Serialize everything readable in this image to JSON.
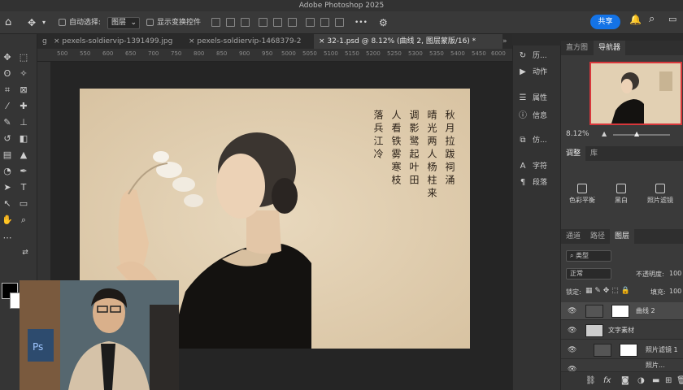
{
  "app": {
    "title": "Adobe Photoshop 2025"
  },
  "options_bar": {
    "auto_select_label": "自动选择:",
    "auto_select_value": "图层",
    "show_transform_label": "显示变换控件",
    "more": "•••",
    "share": "共享"
  },
  "tabs": [
    {
      "label": "g"
    },
    {
      "label": "pexels-soldiervip-1391499.jpg",
      "close": "×"
    },
    {
      "label": "pexels-soldiervip-1468379-2",
      "close": "×"
    },
    {
      "label": "32-1.psd @ 8.12% (曲线 2, 图层蒙版/16) *",
      "close": "×"
    }
  ],
  "ruler_marks": [
    "500",
    "550",
    "600",
    "650",
    "700",
    "750",
    "800",
    "850",
    "900",
    "950",
    "5000",
    "5050",
    "5100",
    "5150",
    "5200",
    "5250",
    "5300",
    "5350",
    "5400",
    "5450",
    "6000"
  ],
  "poem_columns": [
    "秋月拉跋祠涌",
    "晴光两人杨柱来",
    "调影鹭起叶田",
    "人看铁雾寒枝",
    "落兵江冷"
  ],
  "mid_panel": [
    {
      "icon": "history-icon",
      "glyph": "↻",
      "label": "历..."
    },
    {
      "icon": "actions-icon",
      "glyph": "▶",
      "label": "动作"
    },
    {
      "icon": "properties-icon",
      "glyph": "☰",
      "label": "属性"
    },
    {
      "icon": "info-icon",
      "glyph": "ⓘ",
      "label": "信息"
    },
    {
      "icon": "clone-source-icon",
      "glyph": "⧉",
      "label": "仿..."
    },
    {
      "icon": "character-icon",
      "glyph": "A",
      "label": "字符"
    },
    {
      "icon": "paragraph-icon",
      "glyph": "¶",
      "label": "段落"
    }
  ],
  "nav_panel": {
    "tabs": [
      "直方图",
      "导航器"
    ],
    "active": "导航器",
    "zoom": "8.12%"
  },
  "adjust_panel": {
    "tabs": [
      "调整",
      "库"
    ],
    "items": [
      {
        "label": "色彩平衡"
      },
      {
        "label": "黑白"
      },
      {
        "label": "照片滤镜"
      }
    ]
  },
  "layers_panel": {
    "tabs": [
      "通道",
      "路径",
      "图层"
    ],
    "active": "图层",
    "filter_label": "类型",
    "blend_mode": "正常",
    "opacity_label": "不透明度:",
    "opacity_value": "100",
    "lock_label": "锁定:",
    "fill_label": "填充:",
    "fill_value": "100",
    "layers": [
      {
        "name": "曲线 2"
      },
      {
        "name": "文字素材"
      },
      {
        "name": "照片滤镜 1"
      },
      {
        "name": "照片..."
      }
    ],
    "footer_icons": [
      "link-icon",
      "fx-icon",
      "mask-icon",
      "adjustment-icon",
      "folder-icon",
      "new-layer-icon",
      "trash-icon"
    ]
  },
  "colors": {
    "accent": "#1473e6",
    "nav_frame": "#d8373b",
    "paper": "#e2d0b3"
  }
}
